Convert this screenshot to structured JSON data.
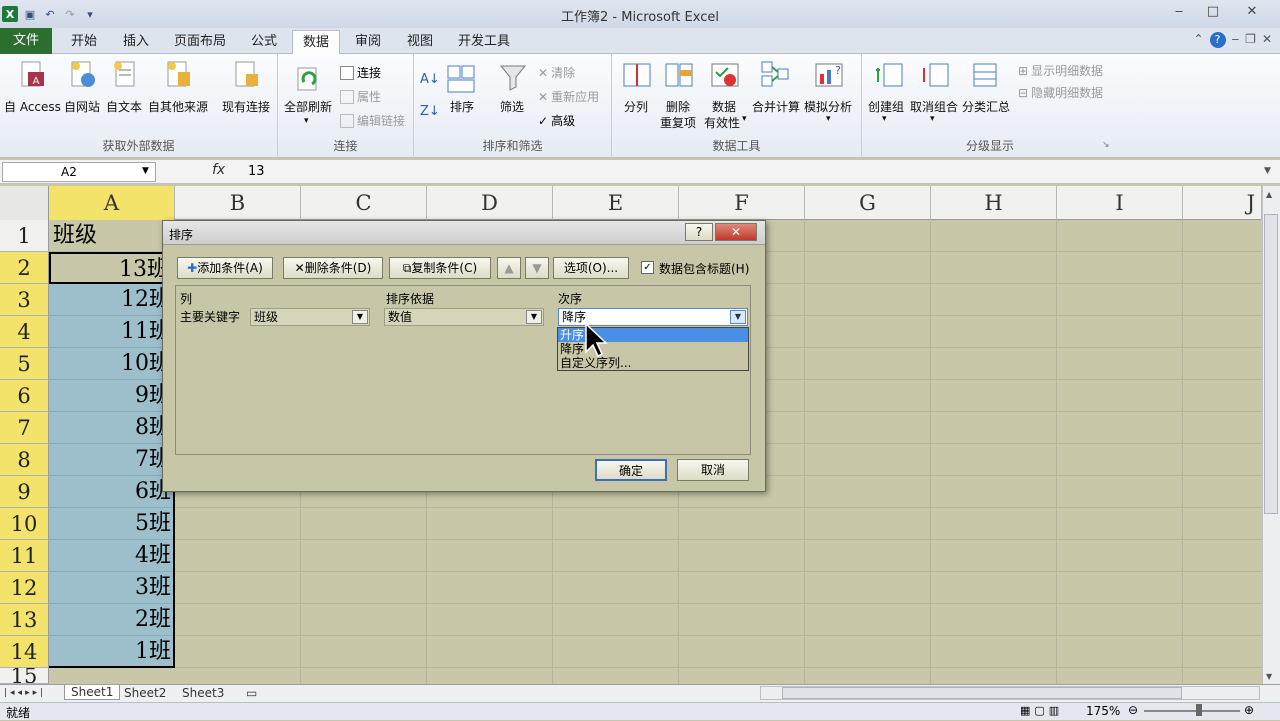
{
  "window": {
    "title": "工作簿2 - Microsoft Excel",
    "min": "‒",
    "max": "□",
    "close": "✕"
  },
  "tabs": [
    "文件",
    "开始",
    "插入",
    "页面布局",
    "公式",
    "数据",
    "审阅",
    "视图",
    "开发工具"
  ],
  "ribbon": {
    "ext": {
      "label": "获取外部数据",
      "access": "自 Access",
      "web": "自网站",
      "text": "自文本",
      "other": "自其他来源",
      "existing": "现有连接"
    },
    "conn": {
      "label": "连接",
      "refresh": "全部刷新",
      "connections": "连接",
      "properties": "属性",
      "editlinks": "编辑链接"
    },
    "sort": {
      "label": "排序和筛选",
      "sort": "排序",
      "filter": "筛选",
      "clear": "清除",
      "reapply": "重新应用",
      "advanced": "高级"
    },
    "tools": {
      "label": "数据工具",
      "split": "分列",
      "dedup1": "删除",
      "dedup2": "重复项",
      "valid1": "数据",
      "valid2": "有效性",
      "consolidate": "合并计算",
      "whatif": "模拟分析"
    },
    "outline": {
      "label": "分级显示",
      "group": "创建组",
      "ungroup": "取消组合",
      "subtotal": "分类汇总",
      "show": "显示明细数据",
      "hide": "隐藏明细数据"
    }
  },
  "formula": {
    "namebox": "A2",
    "fx": "fx",
    "value": "13"
  },
  "columns": [
    "A",
    "B",
    "C",
    "D",
    "E",
    "F",
    "G",
    "H",
    "I",
    "J"
  ],
  "rows": [
    {
      "n": "1",
      "v": "班级"
    },
    {
      "n": "2",
      "v": "13班"
    },
    {
      "n": "3",
      "v": "12班"
    },
    {
      "n": "4",
      "v": "11班"
    },
    {
      "n": "5",
      "v": "10班"
    },
    {
      "n": "6",
      "v": "9班"
    },
    {
      "n": "7",
      "v": "8班"
    },
    {
      "n": "8",
      "v": "7班"
    },
    {
      "n": "9",
      "v": "6班"
    },
    {
      "n": "10",
      "v": "5班"
    },
    {
      "n": "11",
      "v": "4班"
    },
    {
      "n": "12",
      "v": "3班"
    },
    {
      "n": "13",
      "v": "2班"
    },
    {
      "n": "14",
      "v": "1班"
    },
    {
      "n": "15",
      "v": ""
    }
  ],
  "sheets": [
    "Sheet1",
    "Sheet2",
    "Sheet3"
  ],
  "status": {
    "ready": "就绪",
    "zoom": "175%"
  },
  "dialog": {
    "title": "排序",
    "help": "?",
    "close": "✕",
    "add": "添加条件(A)",
    "delete": "删除条件(D)",
    "copy": "复制条件(C)",
    "options": "选项(O)...",
    "hasheader": "数据包含标题(H)",
    "col_header": "列",
    "basis_header": "排序依据",
    "order_header": "次序",
    "primary": "主要关键字",
    "col_value": "班级",
    "basis_value": "数值",
    "order_value": "降序",
    "dropdown": [
      "升序",
      "降序",
      "自定义序列..."
    ],
    "ok": "确定",
    "cancel": "取消"
  }
}
